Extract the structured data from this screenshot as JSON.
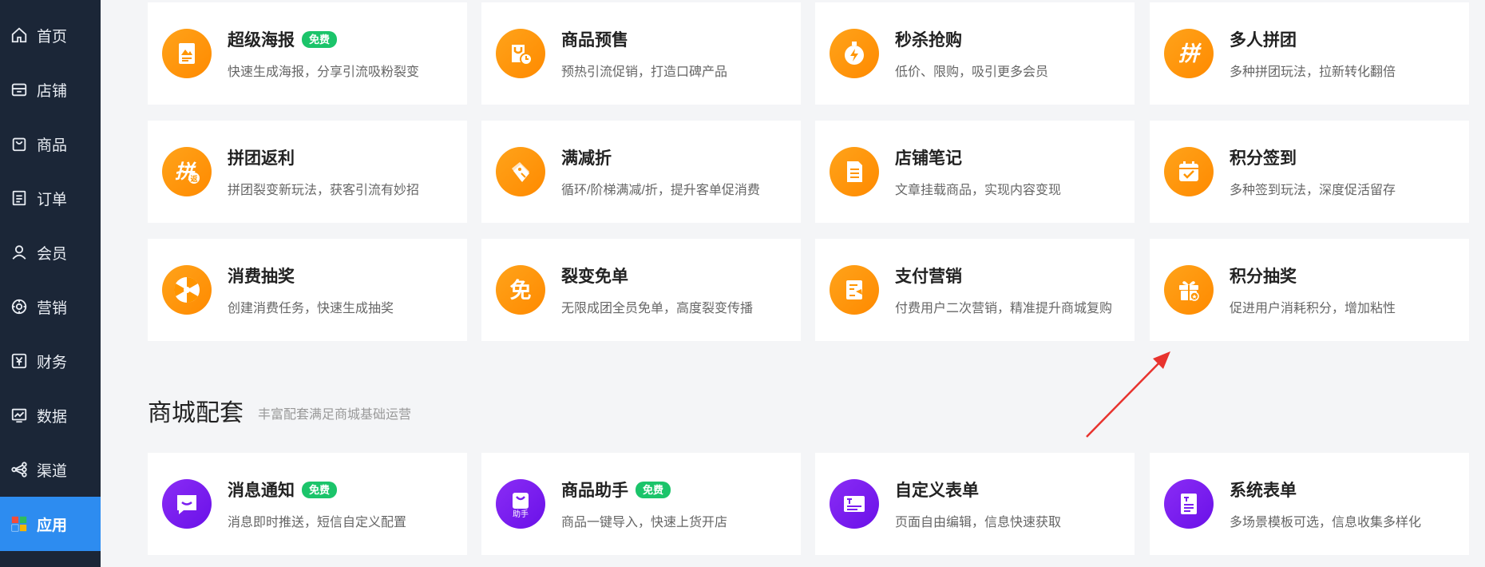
{
  "sidebar": {
    "items": [
      {
        "label": "首页",
        "icon": "home-icon"
      },
      {
        "label": "店铺",
        "icon": "store-icon"
      },
      {
        "label": "商品",
        "icon": "bag-icon"
      },
      {
        "label": "订单",
        "icon": "order-icon"
      },
      {
        "label": "会员",
        "icon": "user-icon"
      },
      {
        "label": "营销",
        "icon": "marketing-icon"
      },
      {
        "label": "财务",
        "icon": "finance-icon"
      },
      {
        "label": "数据",
        "icon": "chart-icon"
      },
      {
        "label": "渠道",
        "icon": "channel-icon"
      },
      {
        "label": "应用",
        "icon": "apps-icon",
        "active": true
      }
    ]
  },
  "marketing_cards": [
    {
      "title": "超级海报",
      "badge": "免费",
      "desc": "快速生成海报，分享引流吸粉裂变",
      "icon": "poster-icon"
    },
    {
      "title": "商品预售",
      "badge": "",
      "desc": "预热引流促销，打造口碑产品",
      "icon": "presale-icon"
    },
    {
      "title": "秒杀抢购",
      "badge": "",
      "desc": "低价、限购，吸引更多会员",
      "icon": "flash-sale-icon"
    },
    {
      "title": "多人拼团",
      "badge": "",
      "desc": "多种拼团玩法，拉新转化翻倍",
      "icon": "group-buy-icon"
    },
    {
      "title": "拼团返利",
      "badge": "",
      "desc": "拼团裂变新玩法，获客引流有妙招",
      "icon": "group-rebate-icon"
    },
    {
      "title": "满减折",
      "badge": "",
      "desc": "循环/阶梯满减/折，提升客单促消费",
      "icon": "discount-tag-icon"
    },
    {
      "title": "店铺笔记",
      "badge": "",
      "desc": "文章挂载商品，实现内容变现",
      "icon": "note-icon"
    },
    {
      "title": "积分签到",
      "badge": "",
      "desc": "多种签到玩法，深度促活留存",
      "icon": "checkin-calendar-icon"
    },
    {
      "title": "消费抽奖",
      "badge": "",
      "desc": "创建消费任务，快速生成抽奖",
      "icon": "lottery-wheel-icon"
    },
    {
      "title": "裂变免单",
      "badge": "",
      "desc": "无限成团全员免单，高度裂变传播",
      "icon": "free-order-icon"
    },
    {
      "title": "支付营销",
      "badge": "",
      "desc": "付费用户二次营销，精准提升商城复购",
      "icon": "payment-marketing-icon"
    },
    {
      "title": "积分抽奖",
      "badge": "",
      "desc": "促进用户消耗积分，增加粘性",
      "icon": "gift-box-icon"
    }
  ],
  "section": {
    "title": "商城配套",
    "subtitle": "丰富配套满足商城基础运营"
  },
  "mall_cards": [
    {
      "title": "消息通知",
      "badge": "免费",
      "desc": "消息即时推送，短信自定义配置",
      "icon": "message-icon"
    },
    {
      "title": "商品助手",
      "badge": "免费",
      "desc": "商品一键导入，快速上货开店",
      "icon": "product-assistant-icon",
      "icon_text": "助手"
    },
    {
      "title": "自定义表单",
      "badge": "",
      "desc": "页面自由编辑，信息快速获取",
      "icon": "custom-form-icon"
    },
    {
      "title": "系统表单",
      "badge": "",
      "desc": "多场景模板可选，信息收集多样化",
      "icon": "system-form-icon"
    }
  ],
  "colors": {
    "sidebar_bg": "#1b2637",
    "active": "#2d8cf0",
    "orange": "#ff9500",
    "purple": "#7a1ff0",
    "badge_green": "#1bc46a",
    "arrow_red": "#e8332e"
  }
}
